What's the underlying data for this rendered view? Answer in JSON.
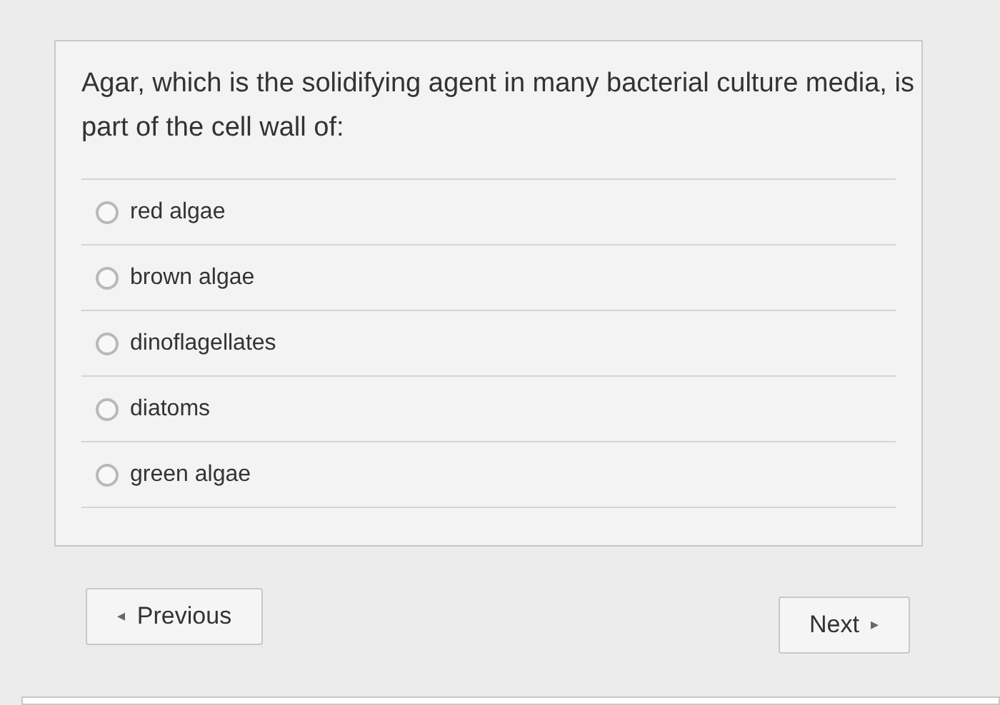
{
  "question": "Agar, which is the solidifying agent in many bacterial culture media, is part of the cell wall of:",
  "options": [
    {
      "label": "red algae",
      "selected": false
    },
    {
      "label": "brown algae",
      "selected": false
    },
    {
      "label": "dinoflagellates",
      "selected": false
    },
    {
      "label": "diatoms",
      "selected": false
    },
    {
      "label": "green algae",
      "selected": false
    }
  ],
  "previous": {
    "icon": "◂",
    "label": "Previous"
  },
  "next": {
    "label": "Next",
    "icon": "▸"
  }
}
